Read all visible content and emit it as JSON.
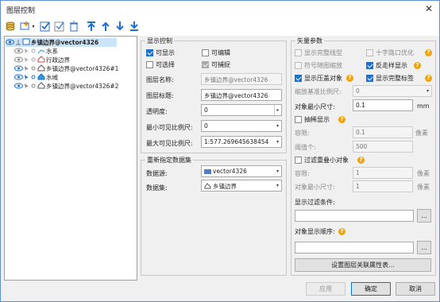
{
  "window": {
    "title": "图层控制",
    "close_glyph": "✕"
  },
  "toolbar": {
    "icons": [
      "layer-stack-icon",
      "add-layer-icon",
      "dropdown-arrow-icon",
      "check-all-icon",
      "check-some-icon",
      "delete-icon",
      "move-top-icon",
      "move-up-icon",
      "move-down-icon",
      "move-bottom-icon"
    ]
  },
  "tree": {
    "root": "乡镇边界@vector4326",
    "items": [
      "水系",
      "行政边界",
      "乡镇边界@vector4326#1",
      "水域",
      "乡镇边界@vector4326#2"
    ]
  },
  "display": {
    "group_title": "显示控制",
    "visible": "可显示",
    "editable": "可编辑",
    "selectable": "可选择",
    "snappable": "可捕捉",
    "name_label": "图层名称:",
    "name_value": "乡镇边界@vector4326",
    "caption_label": "图层标题:",
    "caption_value": "乡镇边界@vector4326",
    "opacity_label": "透明度:",
    "opacity_value": "0",
    "min_scale_label": "最小可见比例尺:",
    "min_scale_value": "0",
    "max_scale_label": "最大可见比例尺:",
    "max_scale_value": "1:577.269645638454"
  },
  "dataset": {
    "group_title": "重新指定数据集",
    "source_label": "数据源:",
    "source_value": "vector4326",
    "set_label": "数据集:",
    "set_value": "乡镇边界"
  },
  "vector": {
    "group_title": "矢量参数",
    "full_line": "显示完整线型",
    "crossroad": "十字路口优化",
    "symbol_scale": "符号随图缩放",
    "antialias": "反走样显示",
    "overlap": "显示压盖对象",
    "full_label": "显示完整标签",
    "ref_scale_label": "缩放基准比例尺:",
    "ref_scale_value": "0",
    "min_size_label": "对象最小尺寸:",
    "min_size_value": "0.1",
    "min_size_unit": "mm",
    "thin": "抽稀显示",
    "tol_label": "容限:",
    "tol_value": "0.1",
    "tol_unit": "像素",
    "threshold_label": "阈值个:",
    "threshold_value": "500",
    "filter_overlap": "过滤重叠小对象",
    "tol2_label": "容限:",
    "tol2_value": "1",
    "tol2_unit": "像素",
    "min_size2_label": "对象最小尺寸:",
    "min_size2_value": "1",
    "min_size2_unit": "像素",
    "filter_cond_label": "显示过滤条件:",
    "filter_cond_value": "",
    "order_label": "对象显示顺序:",
    "order_value": "",
    "browse": "...",
    "relate_button": "设置图层关联属性表..."
  },
  "footer": {
    "apply": "应用",
    "ok": "确定",
    "cancel": "取消"
  }
}
